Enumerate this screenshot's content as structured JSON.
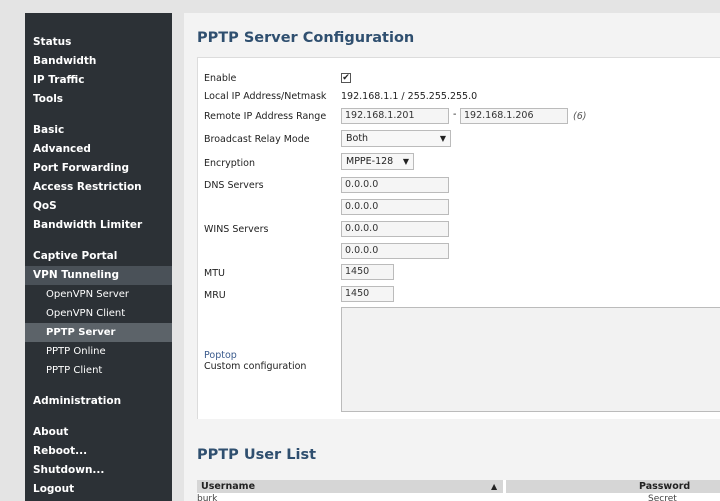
{
  "sidebar": {
    "items": [
      {
        "label": "Status"
      },
      {
        "label": "Bandwidth"
      },
      {
        "label": "IP Traffic"
      },
      {
        "label": "Tools"
      },
      {
        "label": "Basic"
      },
      {
        "label": "Advanced"
      },
      {
        "label": "Port Forwarding"
      },
      {
        "label": "Access Restriction"
      },
      {
        "label": "QoS"
      },
      {
        "label": "Bandwidth Limiter"
      },
      {
        "label": "Captive Portal"
      },
      {
        "label": "VPN Tunneling"
      },
      {
        "label": "OpenVPN Server"
      },
      {
        "label": "OpenVPN Client"
      },
      {
        "label": "PPTP Server"
      },
      {
        "label": "PPTP Online"
      },
      {
        "label": "PPTP Client"
      },
      {
        "label": "Administration"
      },
      {
        "label": "About"
      },
      {
        "label": "Reboot..."
      },
      {
        "label": "Shutdown..."
      },
      {
        "label": "Logout"
      }
    ]
  },
  "config": {
    "title": "PPTP Server Configuration",
    "enable_label": "Enable",
    "enable_checked": "✔",
    "local_ip_label": "Local IP Address/Netmask",
    "local_ip_value": "192.168.1.1 / 255.255.255.0",
    "remote_range_label": "Remote IP Address Range",
    "remote_range_start": "192.168.1.201",
    "remote_range_sep": "-",
    "remote_range_end": "192.168.1.206",
    "remote_range_count": "(6)",
    "broadcast_label": "Broadcast Relay Mode",
    "broadcast_value": "Both",
    "encryption_label": "Encryption",
    "encryption_value": "MPPE-128",
    "dns_label": "DNS Servers",
    "dns_1": "0.0.0.0",
    "dns_2": "0.0.0.0",
    "wins_label": "WINS Servers",
    "wins_1": "0.0.0.0",
    "wins_2": "0.0.0.0",
    "mtu_label": "MTU",
    "mtu_value": "1450",
    "mru_label": "MRU",
    "mru_value": "1450",
    "poptop_link": "Poptop",
    "custom_label": "Custom configuration",
    "custom_value": ""
  },
  "user_list": {
    "title": "PPTP User List",
    "columns": [
      "Username",
      "Password"
    ],
    "sort_icon": "▲",
    "rows": [
      {
        "username": "burk",
        "password": "Secret"
      }
    ]
  },
  "colors": {
    "sidebar_bg": "#2c3136",
    "section_bg": "#4a5158",
    "selected_bg": "#5c6369",
    "title_color": "#2f4f6f",
    "link_color": "#3a5a8c"
  }
}
